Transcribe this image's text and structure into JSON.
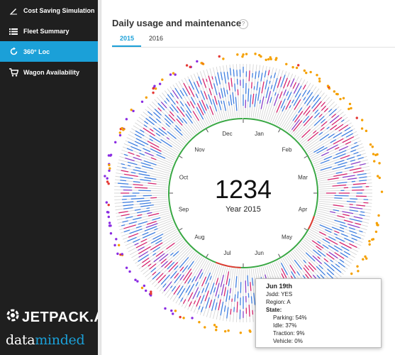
{
  "sidebar": {
    "items": [
      {
        "label": "Cost Saving Simulation",
        "icon": "pencil-icon",
        "active": false
      },
      {
        "label": "Fleet Summary",
        "icon": "list-icon",
        "active": false
      },
      {
        "label": "360° Loc",
        "icon": "refresh-icon",
        "active": true
      },
      {
        "label": "Wagon Availability",
        "icon": "cart-icon",
        "active": false
      }
    ],
    "brand": {
      "name": "JETPACK.AI",
      "partner_prefix": "data",
      "partner_suffix": "minded"
    }
  },
  "main": {
    "title": "Daily usage and maintenance",
    "help_glyph": "?",
    "tabs": [
      {
        "label": "2015",
        "active": true
      },
      {
        "label": "2016",
        "active": false
      }
    ]
  },
  "chart_data": {
    "type": "radial-bar",
    "center_value": "1234",
    "center_label": "Year 2015",
    "months": [
      "Jan",
      "Feb",
      "Mar",
      "Apr",
      "May",
      "Jun",
      "Jul",
      "Aug",
      "Sep",
      "Oct",
      "Nov",
      "Dec"
    ],
    "state_colors": {
      "parking": "#d6d6d6",
      "idle": "#3f7fe0",
      "traction": "#d6256e",
      "vehicle": "#8a3fc9"
    },
    "dot_colors": [
      "#f5a000",
      "#8a2be2",
      "#e53935"
    ]
  },
  "tooltip": {
    "date": "Jun 19th",
    "jsdd": "Jsdd: YES",
    "region": "Region: A",
    "state_label": "State:",
    "parking": "Parking: 54%",
    "idle": "Idle: 37%",
    "traction": "Traction: 9%",
    "vehicle": "Vehicle: 0%"
  }
}
